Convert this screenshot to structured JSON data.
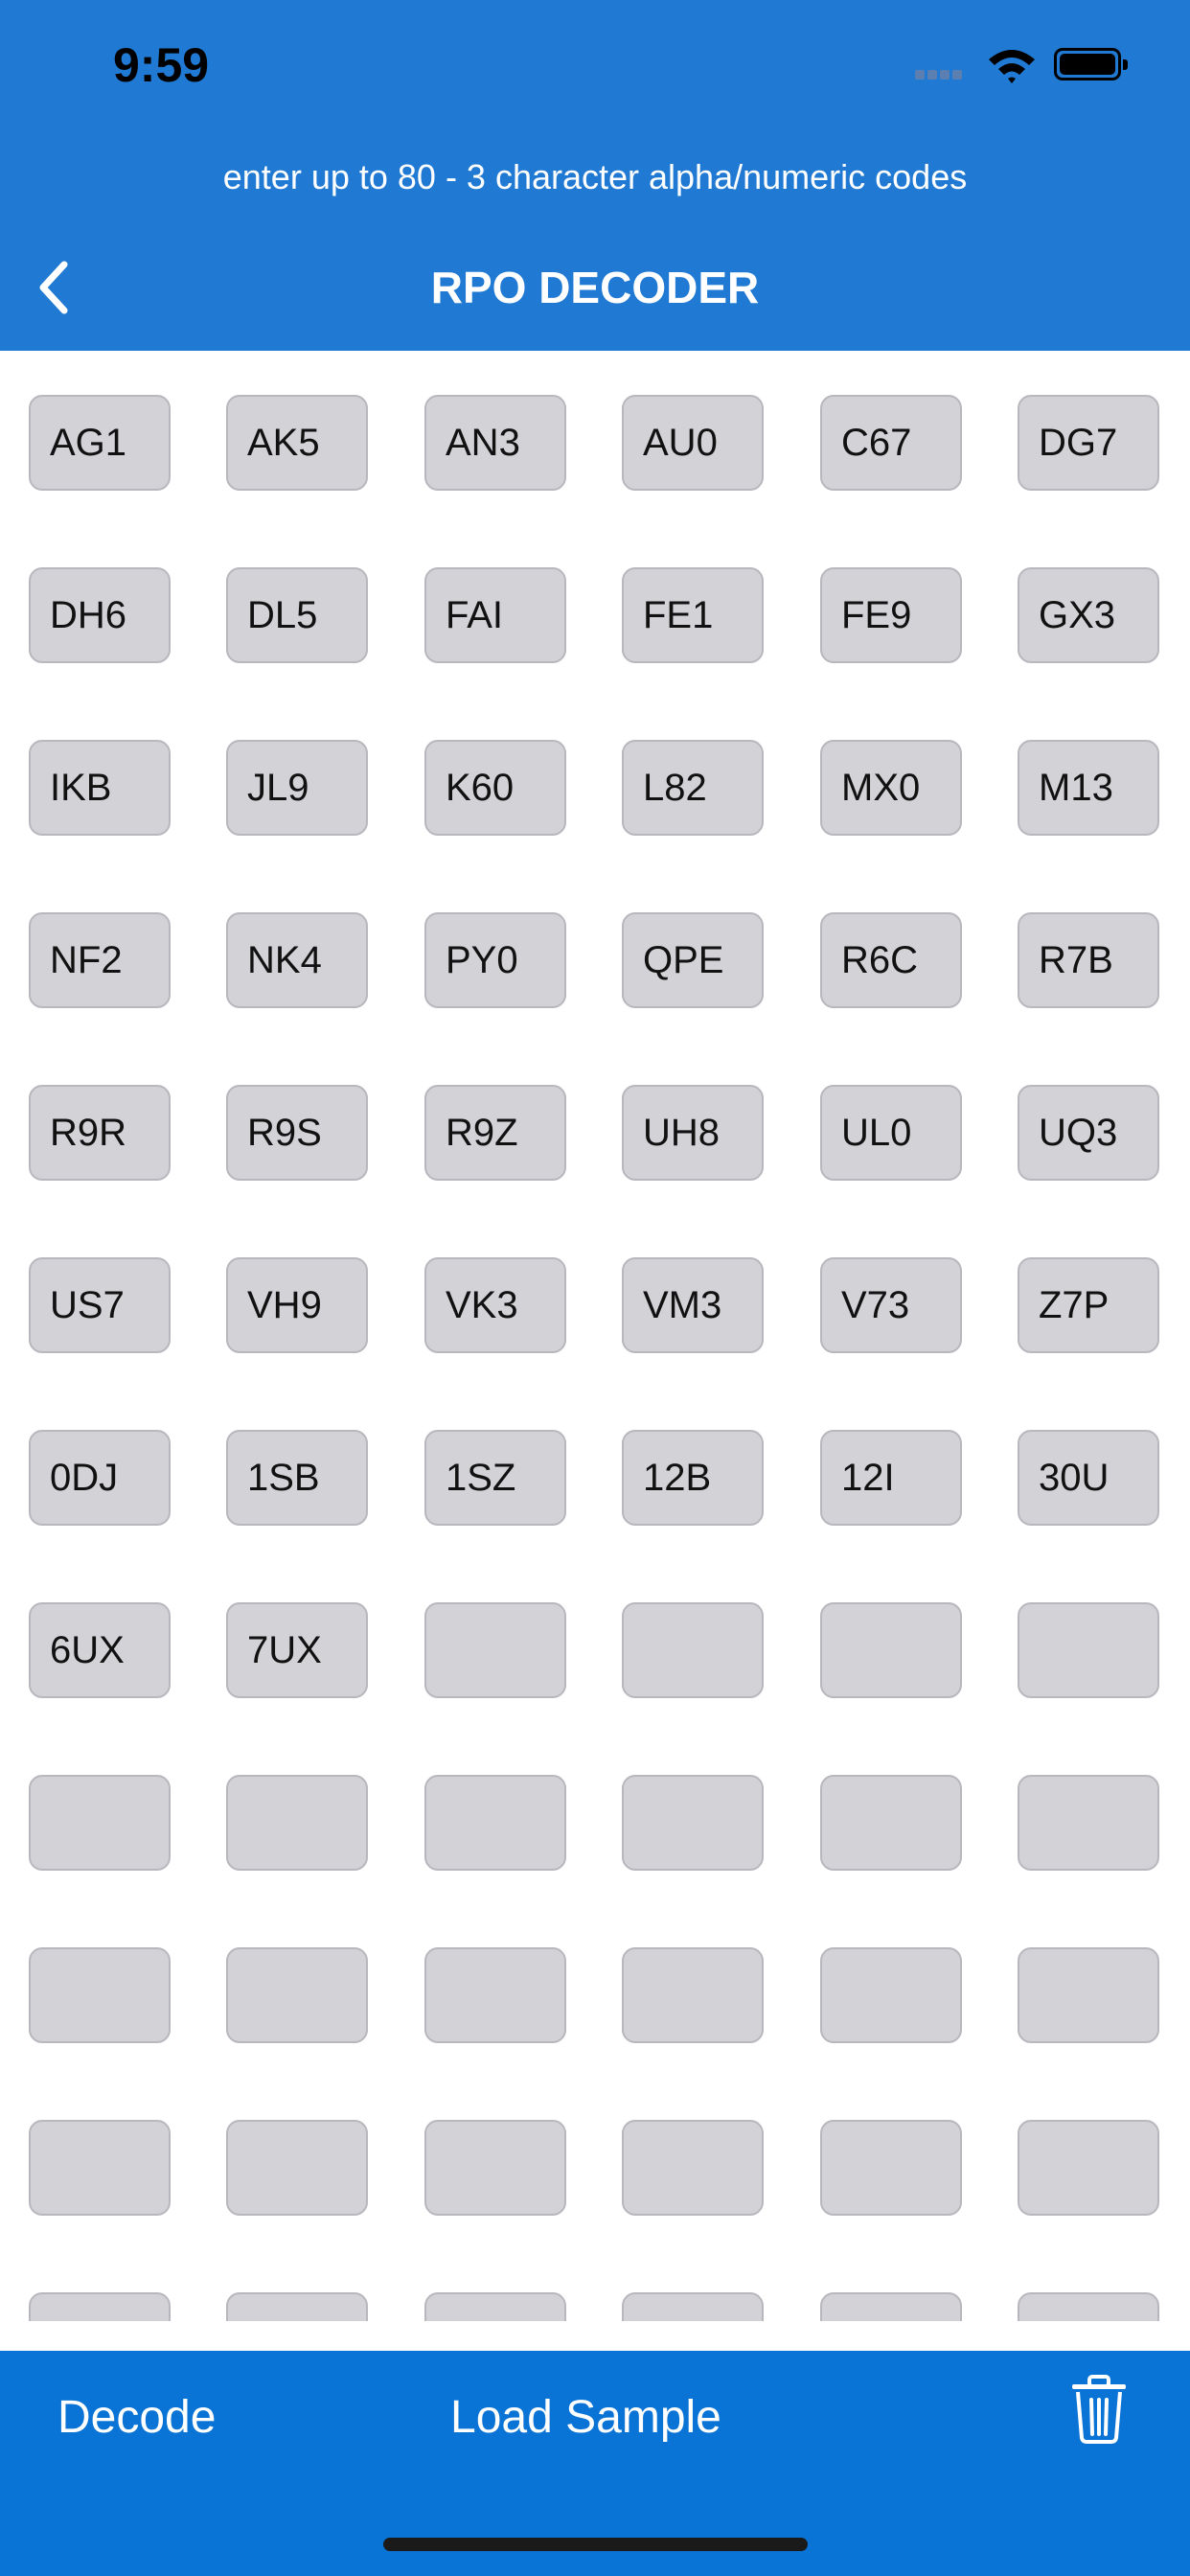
{
  "status_bar": {
    "time": "9:59"
  },
  "header": {
    "subtitle": "enter up to 80 - 3 character alpha/numeric codes",
    "title": "RPO DECODER"
  },
  "codes": [
    "AG1",
    "AK5",
    "AN3",
    "AU0",
    "C67",
    "DG7",
    "DH6",
    "DL5",
    "FAI",
    "FE1",
    "FE9",
    "GX3",
    "IKB",
    "JL9",
    "K60",
    "L82",
    "MX0",
    "M13",
    "NF2",
    "NK4",
    "PY0",
    "QPE",
    "R6C",
    "R7B",
    "R9R",
    "R9S",
    "R9Z",
    "UH8",
    "UL0",
    "UQ3",
    "US7",
    "VH9",
    "VK3",
    "VM3",
    "V73",
    "Z7P",
    "0DJ",
    "1SB",
    "1SZ",
    "12B",
    "12I",
    "30U",
    "6UX",
    "7UX",
    "",
    "",
    "",
    "",
    "",
    "",
    "",
    "",
    "",
    "",
    "",
    "",
    "",
    "",
    "",
    "",
    "",
    "",
    "",
    "",
    "",
    "",
    "",
    "",
    "",
    "",
    "",
    ""
  ],
  "toolbar": {
    "decode_label": "Decode",
    "load_sample_label": "Load Sample"
  },
  "icons": {
    "back": "chevron-left-icon",
    "trash": "trash-icon",
    "wifi": "wifi-icon",
    "battery": "battery-icon",
    "signal": "cellular-signal-icon"
  },
  "colors": {
    "header": "#2079d3",
    "toolbar": "#0a74d6",
    "cell": "#d2d2d7"
  }
}
